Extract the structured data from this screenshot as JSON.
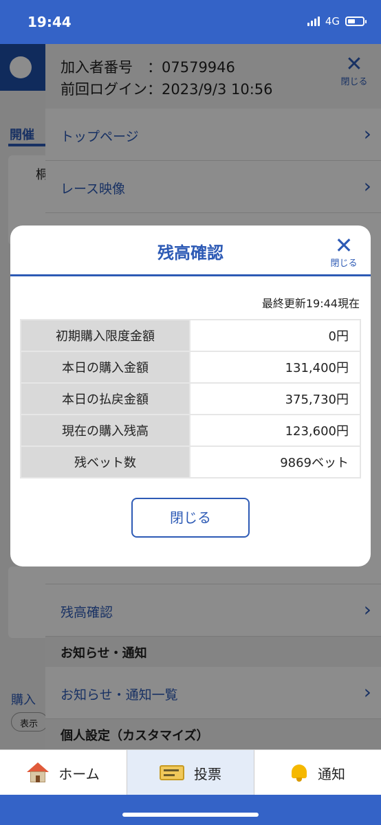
{
  "status_bar": {
    "time": "19:44",
    "network": "4G"
  },
  "background_app": {
    "tab_label": "開催",
    "card_text": "桐",
    "bottom_label": "購入",
    "pill_label": "表示"
  },
  "side_menu": {
    "account_number_label": "加入者番号　：",
    "account_number": "07579946",
    "last_login_label": "前回ログイン：",
    "last_login": "2023/9/3 10:56",
    "close_label": "閉じる",
    "items": [
      {
        "label": "トップページ"
      },
      {
        "label": "レース映像"
      },
      {
        "label": "残高確認"
      },
      {
        "label": "お知らせ・通知一覧"
      }
    ],
    "sections": [
      {
        "label": "お知らせ・通知"
      },
      {
        "label": "個人設定（カスタマイズ）"
      }
    ]
  },
  "modal": {
    "title": "残高確認",
    "close_label": "閉じる",
    "updated_text": "最終更新19:44現在",
    "rows": [
      {
        "label": "初期購入限度金額",
        "value": "0円"
      },
      {
        "label": "本日の購入金額",
        "value": "131,400円"
      },
      {
        "label": "本日の払戻金額",
        "value": "375,730円"
      },
      {
        "label": "現在の購入残高",
        "value": "123,600円"
      },
      {
        "label": "残ベット数",
        "value": "9869ベット"
      }
    ],
    "close_button": "閉じる"
  },
  "bottom_nav": [
    {
      "label": "ホーム",
      "icon": "home-icon"
    },
    {
      "label": "投票",
      "icon": "ticket-icon"
    },
    {
      "label": "通知",
      "icon": "bell-icon"
    }
  ]
}
